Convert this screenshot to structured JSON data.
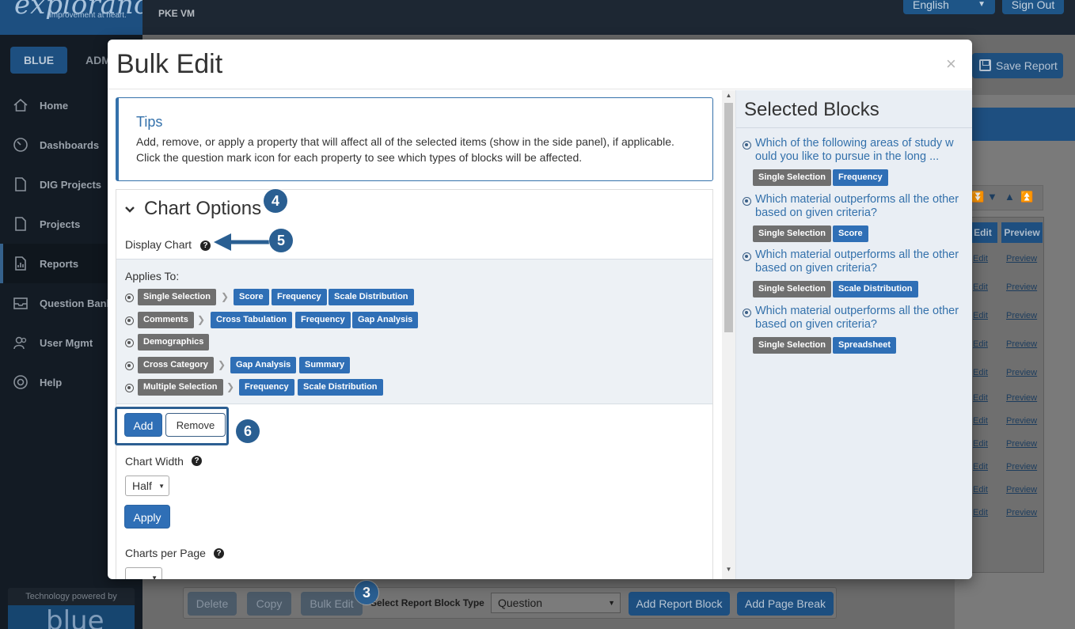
{
  "app": {
    "logo_text": "explorance",
    "logo_tagline": "Improvement at heart.",
    "org_name": "PKE VM",
    "language": "English",
    "sign_out": "Sign Out"
  },
  "sidebar": {
    "tab_blue": "BLUE",
    "tab_admin": "ADM",
    "items": [
      {
        "label": "Home",
        "icon": "home-icon"
      },
      {
        "label": "Dashboards",
        "icon": "gauge-icon"
      },
      {
        "label": "DIG Projects",
        "icon": "document-icon"
      },
      {
        "label": "Projects",
        "icon": "document-icon"
      },
      {
        "label": "Reports",
        "icon": "report-icon",
        "active": true
      },
      {
        "label": "Question Bank",
        "icon": "inbox-icon"
      },
      {
        "label": "User Mgmt",
        "icon": "users-icon"
      },
      {
        "label": "Help",
        "icon": "lifebuoy-icon"
      }
    ],
    "powered_by": "Technology powered by",
    "powered_logo": "blue"
  },
  "background": {
    "save_report": "Save Report",
    "table_headers": [
      "Edit",
      "Preview"
    ],
    "row_edit": "Edit",
    "row_preview": "Preview",
    "bottom": {
      "delete": "Delete",
      "copy": "Copy",
      "bulk_edit": "Bulk Edit",
      "block_type_label": "Select Report Block Type",
      "block_type_value": "Question",
      "add_report_block": "Add Report Block",
      "add_page_break": "Add Page Break"
    }
  },
  "annotations": {
    "b3": "3",
    "b4": "4",
    "b5": "5",
    "b6": "6"
  },
  "modal": {
    "title": "Bulk Edit",
    "close": "×",
    "tips": {
      "title": "Tips",
      "line1": "Add, remove, or apply a property that will affect all of the selected items (show in the side panel), if applicable.",
      "line2": "Click the question mark icon for each property to see which types of blocks will be affected."
    },
    "chart_options": {
      "title": "Chart Options",
      "display_chart_label": "Display Chart",
      "applies_to_label": "Applies To:",
      "applies_rows": [
        {
          "type": "Single Selection",
          "targets": [
            "Score",
            "Frequency",
            "Scale Distribution"
          ]
        },
        {
          "type": "Comments",
          "targets": [
            "Cross Tabulation",
            "Frequency",
            "Gap Analysis"
          ]
        },
        {
          "type": "Demographics",
          "targets": []
        },
        {
          "type": "Cross Category",
          "targets": [
            "Gap Analysis",
            "Summary"
          ]
        },
        {
          "type": "Multiple Selection",
          "targets": [
            "Frequency",
            "Scale Distribution"
          ]
        }
      ],
      "add": "Add",
      "remove": "Remove",
      "chart_width_label": "Chart Width",
      "chart_width_value": "Half",
      "apply": "Apply",
      "charts_per_page_label": "Charts per Page"
    },
    "selected_blocks": {
      "title": "Selected Blocks",
      "items": [
        {
          "line1": "Which of the following areas of study w",
          "line2": "ould you like to pursue in the long ...",
          "tags": [
            "Single Selection",
            "Frequency"
          ]
        },
        {
          "line1": "Which material outperforms all the other",
          "line2": "based on given criteria?",
          "tags": [
            "Single Selection",
            "Score"
          ]
        },
        {
          "line1": "Which material outperforms all the other",
          "line2": "based on given criteria?",
          "tags": [
            "Single Selection",
            "Scale Distribution"
          ]
        },
        {
          "line1": "Which material outperforms all the other",
          "line2": "based on given criteria?",
          "tags": [
            "Single Selection",
            "Spreadsheet"
          ]
        }
      ]
    }
  }
}
